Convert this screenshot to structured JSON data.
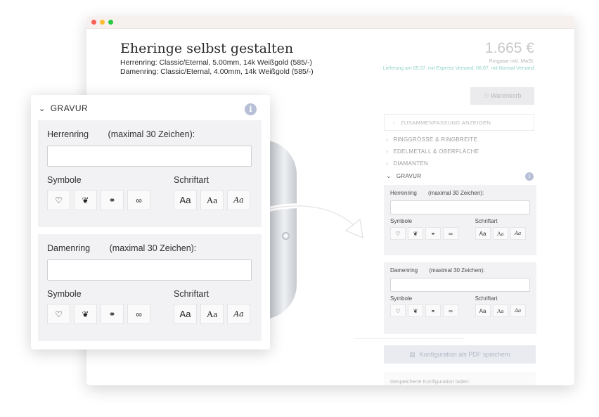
{
  "page": {
    "title": "Eheringe selbst gestalten",
    "spec_men": "Herrenring: Classic/Eternal, 5.00mm, 14k Weißgold (585/-)",
    "spec_women": "Damenring: Classic/Eternal, 4.00mm, 14k Weißgold (585/-)",
    "price": "1.665 €",
    "price_note": "Ringpaar inkl. MwSt.",
    "delivery": "Lieferung am 05.07. mit Express Versand; 06.07. mit Normal Versand",
    "cart_label": "Warenkorb",
    "summary_label": "ZUSAMMENFASSUNG ANZEIGEN",
    "accordion": [
      "RINGGRÖSSE & RINGBREITE",
      "EDELMETALL & OBERFLÄCHE",
      "DIAMANTEN",
      "GRAVUR"
    ],
    "pdf_label": "Konfiguration als PDF speichern",
    "saved_label": "Gespeicherte Konfiguration laden:"
  },
  "gravur": {
    "title": "GRAVUR",
    "info": "i",
    "men_label": "Herrenring",
    "women_label": "Damenring",
    "max_label": "(maximal 30 Zeichen):",
    "symbols_label": "Symbole",
    "font_label": "Schriftart",
    "symbols": [
      "♡",
      "❦",
      "⚭",
      "∞"
    ],
    "symbol_icons": [
      "heart-icon",
      "double-heart-icon",
      "rings-icon",
      "infinity-icon"
    ],
    "fonts": [
      "Aa",
      "Aa",
      "Aa"
    ]
  },
  "colors": {
    "accent_info": "#b7bfd6",
    "delivery_text": "#8fd3c6",
    "panel_bg": "#f2f2f4"
  }
}
